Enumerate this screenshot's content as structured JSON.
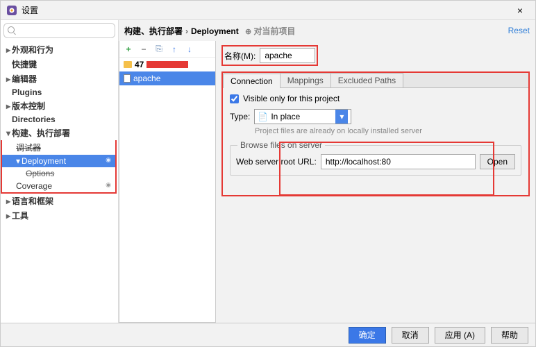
{
  "window": {
    "title": "设置",
    "close": "×"
  },
  "sidebar": {
    "search_placeholder": "",
    "items": [
      {
        "label": "外观和行为",
        "expandable": true
      },
      {
        "label": "快捷键"
      },
      {
        "label": "编辑器",
        "expandable": true
      },
      {
        "label": "Plugins"
      },
      {
        "label": "版本控制",
        "expandable": true,
        "tag": ""
      },
      {
        "label": "Directories",
        "tag": ""
      },
      {
        "label": "构建、执行部署",
        "expandable": true,
        "expanded": true
      },
      {
        "label": "调试器",
        "sub": true,
        "strike": true
      },
      {
        "label": "Deployment",
        "sub": true,
        "selected": true,
        "tag": "◉",
        "expandable": true,
        "expanded": true
      },
      {
        "label": "Options",
        "subsub": true,
        "strike": true
      },
      {
        "label": "Coverage",
        "sub": true,
        "tag": "◉"
      },
      {
        "label": "语言和框架",
        "expandable": true
      },
      {
        "label": "工具",
        "expandable": true
      }
    ]
  },
  "breadcrumb": {
    "a": "构建、执行部署",
    "b": "Deployment",
    "hint": "对当前项目",
    "reset": "Reset"
  },
  "toolbar": {
    "add": "+",
    "remove": "−",
    "copy": "⎘",
    "up": "↑",
    "down": "↓"
  },
  "servers": [
    {
      "label": "47",
      "icon": "folder",
      "masked": true
    },
    {
      "label": "apache",
      "icon": "file",
      "selected": true
    }
  ],
  "detail": {
    "name_label": "名称(M):",
    "name_value": "apache",
    "tabs": {
      "connection": "Connection",
      "mappings": "Mappings",
      "excluded": "Excluded Paths"
    },
    "visible_label": "Visible only for this project",
    "visible_checked": true,
    "type_label": "Type:",
    "type_value": "In place",
    "type_hint": "Project files are already on locally installed server",
    "browse_legend": "Browse files on server",
    "url_label": "Web server root URL:",
    "url_value": "http://localhost:80",
    "open_btn": "Open"
  },
  "footer": {
    "ok": "确定",
    "cancel": "取消",
    "apply": "应用 (A)",
    "help": "帮助"
  },
  "colors": {
    "accent": "#4a86e8",
    "highlight_red": "#e53935"
  }
}
